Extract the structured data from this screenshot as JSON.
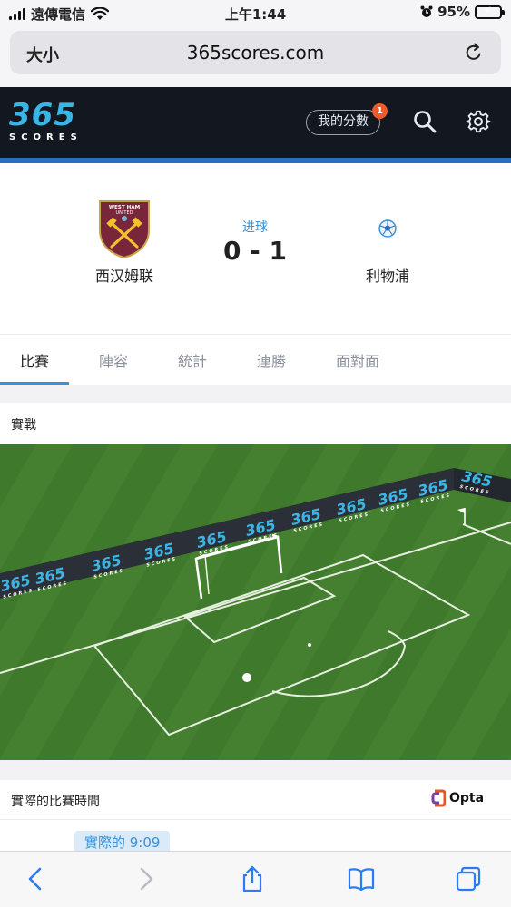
{
  "status_bar": {
    "carrier": "遠傳電信",
    "time": "上午1:44",
    "battery_percent": "95%",
    "battery_level": 0.95
  },
  "browser": {
    "text_size_label": "大小",
    "url": "365scores.com"
  },
  "app_header": {
    "logo_number": "365",
    "logo_text": "SCORES",
    "my_scores_label": "我的分數",
    "notification_count": "1"
  },
  "match": {
    "home_team": "西汉姆联",
    "home_crest_text": "WEST HAM UNITED",
    "away_team": "利物浦",
    "status": "进球",
    "score": "0 - 1"
  },
  "tabs": [
    {
      "label": "比賽",
      "active": true
    },
    {
      "label": "陣容",
      "active": false
    },
    {
      "label": "統計",
      "active": false
    },
    {
      "label": "連勝",
      "active": false
    },
    {
      "label": "面對面",
      "active": false
    }
  ],
  "live": {
    "title": "實戰",
    "board_number": "365",
    "board_text": "SCORES"
  },
  "match_time": {
    "title": "實際的比賽時間",
    "provider": "Opta",
    "time_label": "實際的 9:09"
  },
  "colors": {
    "accent": "#3a91d8",
    "header_bg": "#121720",
    "badge": "#f0592a",
    "pitch_green": "#3f7a2c"
  }
}
